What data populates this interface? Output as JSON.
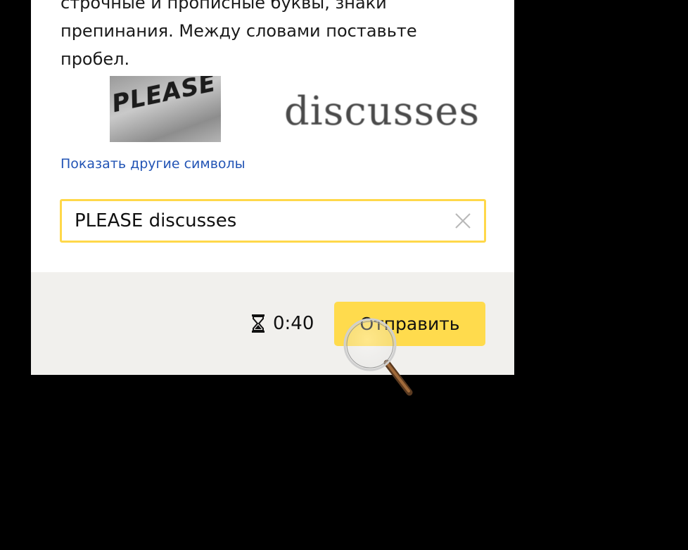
{
  "instructions": "строчные и прописные буквы, знаки препинания. Между словами поставьте пробел.",
  "captcha": {
    "word_1": "PLEASE",
    "word_2": "discusses"
  },
  "show_other_link": "Показать другие символы",
  "answer": {
    "value": "PLEASE discusses"
  },
  "footer": {
    "timer": "0:40",
    "submit_label": "Отправить"
  },
  "colors": {
    "accent": "#ffdb4d",
    "input_border": "#ffd84a",
    "link": "#2254b5",
    "footer_bg": "#f1f0ed"
  },
  "icons": [
    "clear-icon",
    "hourglass-icon",
    "magnifier-cursor-icon"
  ]
}
